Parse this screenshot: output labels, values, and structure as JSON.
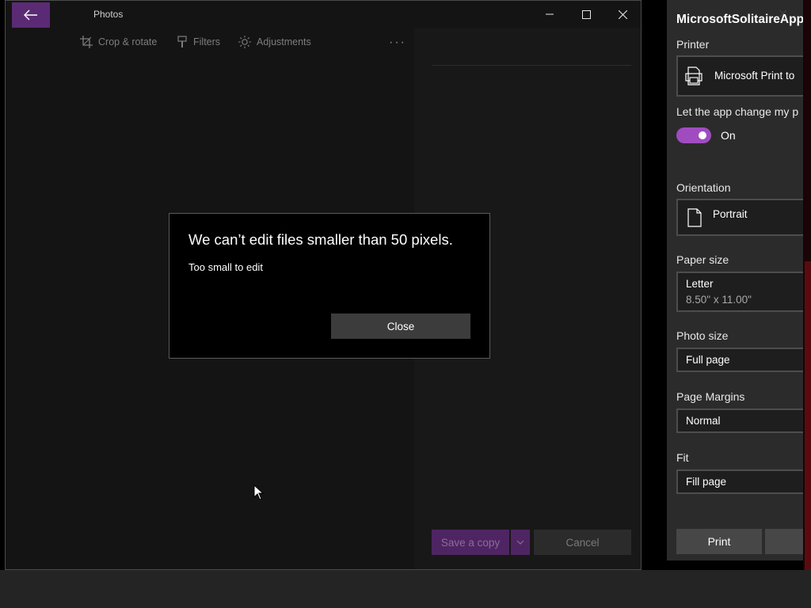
{
  "photos": {
    "title": "Photos",
    "toolbar": {
      "crop": "Crop & rotate",
      "filters": "Filters",
      "adjustments": "Adjustments",
      "more": "···"
    },
    "save_copy": "Save a copy",
    "cancel": "Cancel"
  },
  "dialog": {
    "title": "We can’t edit files smaller than 50 pixels.",
    "message": "Too small to edit",
    "close": "Close"
  },
  "print": {
    "title": "MicrosoftSolitaireAppL",
    "printer_label": "Printer",
    "printer_value": "Microsoft Print to",
    "let_app_label": "Let the app change my p",
    "toggle_state": "On",
    "orientation_label": "Orientation",
    "orientation_value": "Portrait",
    "paper_size_label": "Paper size",
    "paper_size_value": "Letter",
    "paper_size_dims": "8.50\" x 11.00\"",
    "photo_size_label": "Photo size",
    "photo_size_value": "Full page",
    "margins_label": "Page Margins",
    "margins_value": "Normal",
    "fit_label": "Fit",
    "fit_value": "Fill page",
    "print_button": "Print"
  },
  "colors": {
    "accent": "#a04cc0",
    "back_button": "#5b2a74"
  }
}
